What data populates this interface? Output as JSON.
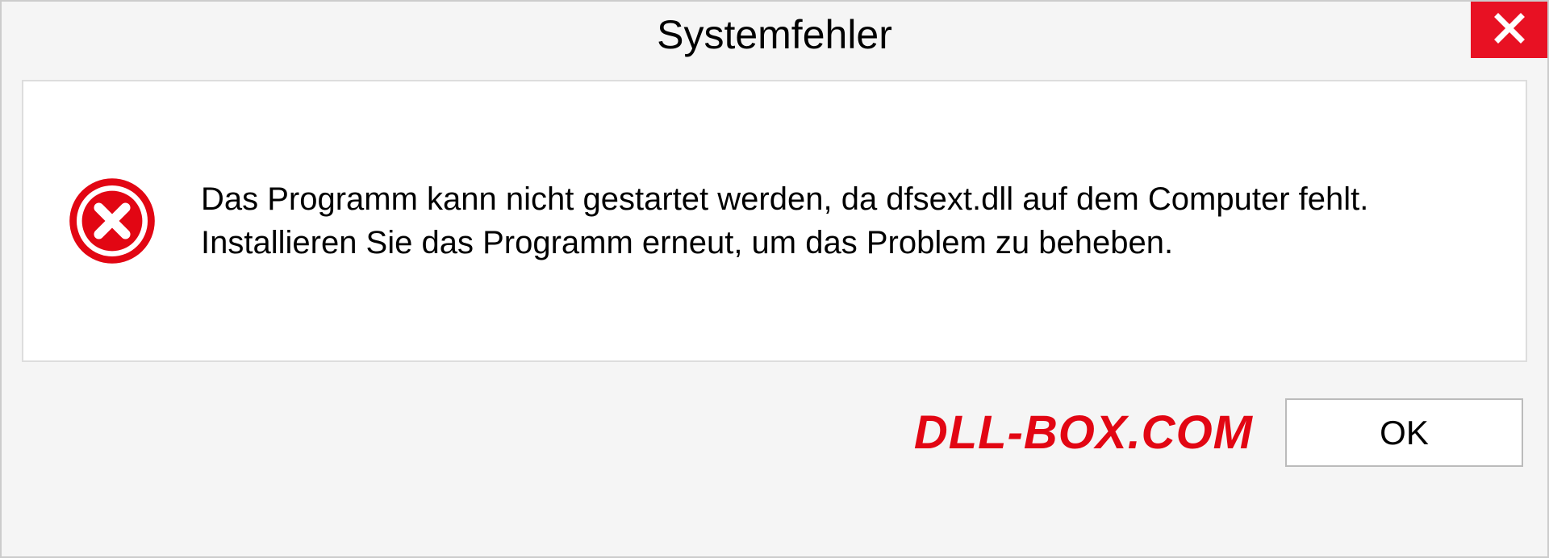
{
  "dialog": {
    "title": "Systemfehler",
    "message": "Das Programm kann nicht gestartet werden, da dfsext.dll auf dem Computer fehlt. Installieren Sie das Programm erneut, um das Problem zu beheben.",
    "ok_label": "OK"
  },
  "watermark": "DLL-BOX.COM",
  "colors": {
    "close_bg": "#e81123",
    "error_icon": "#e20613",
    "watermark": "#e20613"
  }
}
